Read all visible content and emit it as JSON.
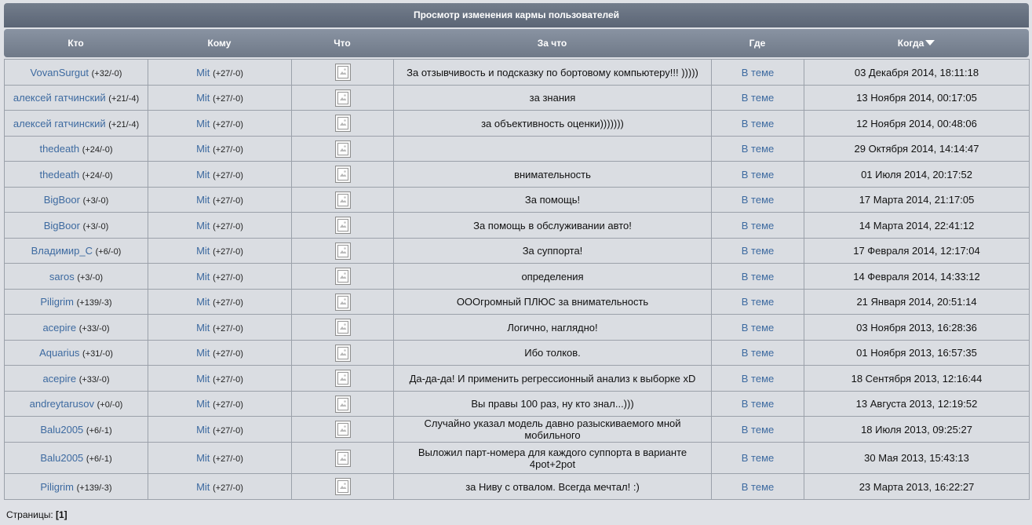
{
  "title": "Просмотр изменения кармы пользователей",
  "columns": {
    "who": "Кто",
    "to": "Кому",
    "what": "Что",
    "for_what": "За что",
    "where": "Где",
    "when": "Когда"
  },
  "rows": [
    {
      "who": "VovanSurgut",
      "who_karma": "(+32/-0)",
      "to": "Mit",
      "to_karma": "(+27/-0)",
      "what_icon": "image-placeholder-icon",
      "reason": "За отзывчивость и подсказку по бортовому компьютеру!!! )))))",
      "where": "В теме",
      "when": "03 Декабря 2014, 18:11:18"
    },
    {
      "who": "алексей гатчинский",
      "who_karma": "(+21/-4)",
      "to": "Mit",
      "to_karma": "(+27/-0)",
      "what_icon": "image-placeholder-icon",
      "reason": "за знания",
      "where": "В теме",
      "when": "13 Ноября 2014, 00:17:05"
    },
    {
      "who": "алексей гатчинский",
      "who_karma": "(+21/-4)",
      "to": "Mit",
      "to_karma": "(+27/-0)",
      "what_icon": "image-placeholder-icon",
      "reason": "за объективность оценки)))))))",
      "where": "В теме",
      "when": "12 Ноября 2014, 00:48:06"
    },
    {
      "who": "thedeath",
      "who_karma": "(+24/-0)",
      "to": "Mit",
      "to_karma": "(+27/-0)",
      "what_icon": "image-placeholder-icon",
      "reason": "",
      "where": "В теме",
      "when": "29 Октября 2014, 14:14:47"
    },
    {
      "who": "thedeath",
      "who_karma": "(+24/-0)",
      "to": "Mit",
      "to_karma": "(+27/-0)",
      "what_icon": "image-placeholder-icon",
      "reason": "внимательность",
      "where": "В теме",
      "when": "01 Июля 2014, 20:17:52"
    },
    {
      "who": "BigBoor",
      "who_karma": "(+3/-0)",
      "to": "Mit",
      "to_karma": "(+27/-0)",
      "what_icon": "image-placeholder-icon",
      "reason": "За помощь!",
      "where": "В теме",
      "when": "17 Марта 2014, 21:17:05"
    },
    {
      "who": "BigBoor",
      "who_karma": "(+3/-0)",
      "to": "Mit",
      "to_karma": "(+27/-0)",
      "what_icon": "image-placeholder-icon",
      "reason": "За помощь в обслуживании авто!",
      "where": "В теме",
      "when": "14 Марта 2014, 22:41:12"
    },
    {
      "who": "Владимир_С",
      "who_karma": "(+6/-0)",
      "to": "Mit",
      "to_karma": "(+27/-0)",
      "what_icon": "image-placeholder-icon",
      "reason": "За суппорта!",
      "where": "В теме",
      "when": "17 Февраля 2014, 12:17:04"
    },
    {
      "who": "saros",
      "who_karma": "(+3/-0)",
      "to": "Mit",
      "to_karma": "(+27/-0)",
      "what_icon": "image-placeholder-icon",
      "reason": "определения",
      "where": "В теме",
      "when": "14 Февраля 2014, 14:33:12"
    },
    {
      "who": "Piligrim",
      "who_karma": "(+139/-3)",
      "to": "Mit",
      "to_karma": "(+27/-0)",
      "what_icon": "image-placeholder-icon",
      "reason": "ОООгромный ПЛЮС за внимательность",
      "where": "В теме",
      "when": "21 Января 2014, 20:51:14"
    },
    {
      "who": "acepire",
      "who_karma": "(+33/-0)",
      "to": "Mit",
      "to_karma": "(+27/-0)",
      "what_icon": "image-placeholder-icon",
      "reason": "Логично, наглядно!",
      "where": "В теме",
      "when": "03 Ноября 2013, 16:28:36"
    },
    {
      "who": "Aquarius",
      "who_karma": "(+31/-0)",
      "to": "Mit",
      "to_karma": "(+27/-0)",
      "what_icon": "image-placeholder-icon",
      "reason": "Ибо толков.",
      "where": "В теме",
      "when": "01 Ноября 2013, 16:57:35"
    },
    {
      "who": "acepire",
      "who_karma": "(+33/-0)",
      "to": "Mit",
      "to_karma": "(+27/-0)",
      "what_icon": "image-placeholder-icon",
      "reason": "Да-да-да! И применить регрессионный анализ к выборке xD",
      "where": "В теме",
      "when": "18 Сентября 2013, 12:16:44"
    },
    {
      "who": "andreytarusov",
      "who_karma": "(+0/-0)",
      "to": "Mit",
      "to_karma": "(+27/-0)",
      "what_icon": "image-placeholder-icon",
      "reason": "Вы правы 100 раз, ну кто знал...)))",
      "where": "В теме",
      "when": "13 Августа 2013, 12:19:52"
    },
    {
      "who": "Balu2005",
      "who_karma": "(+6/-1)",
      "to": "Mit",
      "to_karma": "(+27/-0)",
      "what_icon": "image-placeholder-icon",
      "reason": "Случайно указал модель давно разыскиваемого мной мобильного",
      "where": "В теме",
      "when": "18 Июля 2013, 09:25:27"
    },
    {
      "who": "Balu2005",
      "who_karma": "(+6/-1)",
      "to": "Mit",
      "to_karma": "(+27/-0)",
      "what_icon": "image-placeholder-icon",
      "reason": "Выложил парт-номера для каждого суппорта в варианте 4pot+2pot",
      "where": "В теме",
      "when": "30 Мая 2013, 15:43:13"
    },
    {
      "who": "Piligrim",
      "who_karma": "(+139/-3)",
      "to": "Mit",
      "to_karma": "(+27/-0)",
      "what_icon": "image-placeholder-icon",
      "reason": "за Ниву с отвалом. Всегда мечтал! :)",
      "where": "В теме",
      "when": "23 Марта 2013, 16:22:27"
    }
  ],
  "pager": {
    "label": "Страницы:",
    "current": "[1]"
  },
  "colors": {
    "link": "#3d6aa0",
    "header_bg": "#6f7988",
    "cell_bg": "#dadde2",
    "page_bg": "#dfe1e6"
  }
}
